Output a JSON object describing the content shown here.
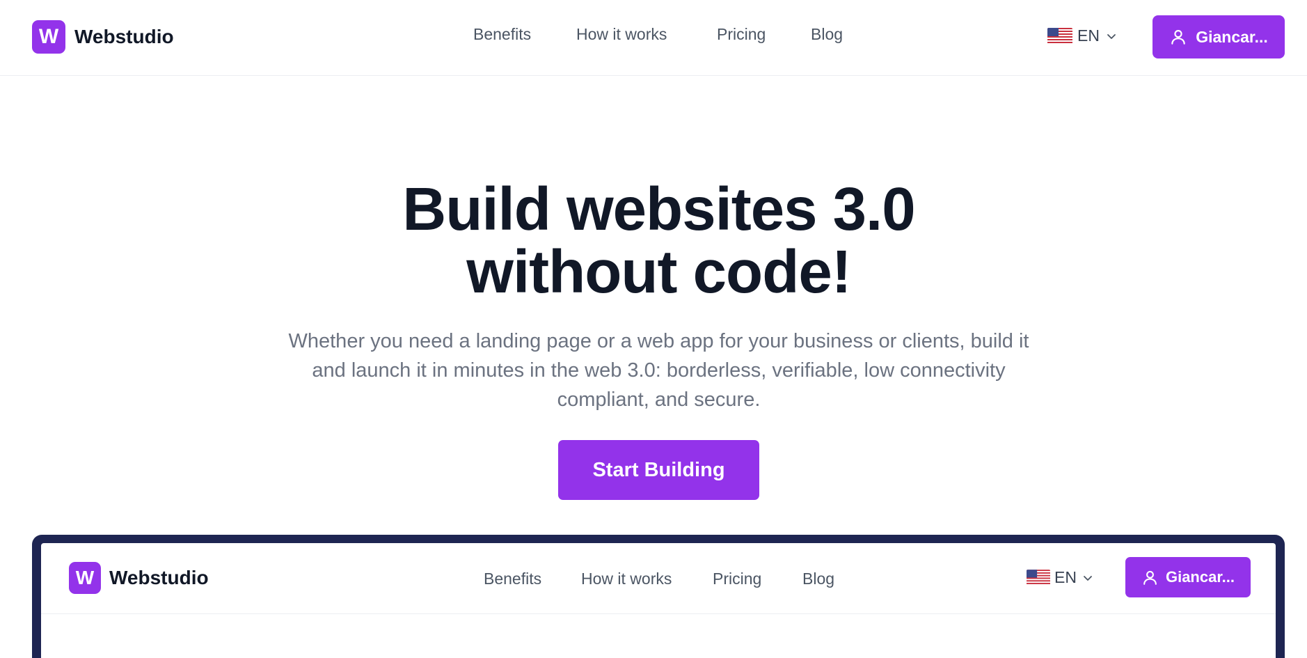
{
  "header": {
    "logo_letter": "W",
    "logo_text": "Webstudio",
    "nav": [
      "Benefits",
      "How it works",
      "Pricing",
      "Blog"
    ],
    "language": "EN",
    "user_button": "Giancar..."
  },
  "hero": {
    "title_line1": "Build websites 3.0",
    "title_line2": "without code!",
    "subtitle_line1": "Whether you need a landing page or a web app for your business or clients, build it",
    "subtitle_line2": "and launch it in minutes in the web 3.0: borderless, verifiable, low connectivity",
    "subtitle_line3": "compliant, and secure.",
    "cta": "Start Building"
  },
  "preview": {
    "logo_letter": "W",
    "logo_text": "Webstudio",
    "nav": [
      "Benefits",
      "How it works",
      "Pricing",
      "Blog"
    ],
    "language": "EN",
    "user_button": "Giancar..."
  },
  "colors": {
    "accent": "#9333ea",
    "heading": "#111827",
    "muted": "#6b7280",
    "frame": "#1e2552"
  },
  "icons": {
    "flag": "us-flag-icon",
    "chevron": "chevron-down-icon",
    "user": "user-icon"
  }
}
